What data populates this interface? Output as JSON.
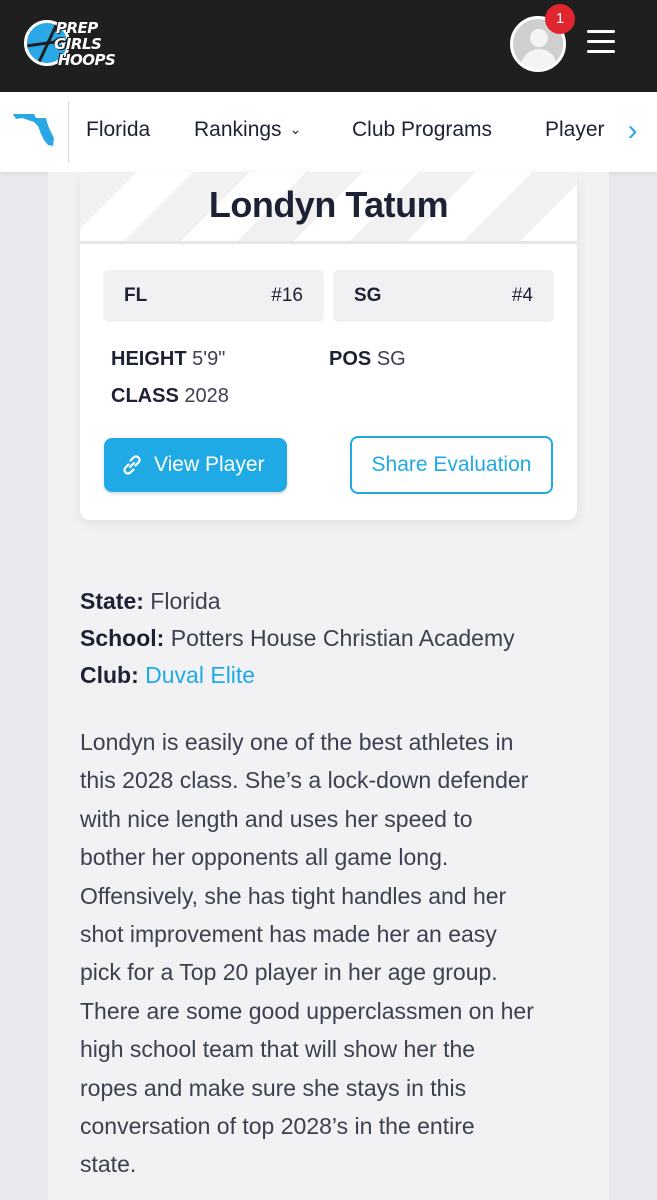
{
  "header": {
    "logo_words": [
      "PREP",
      "GIRLS",
      "HOOPS"
    ],
    "notification_count": "1"
  },
  "nav": {
    "items": [
      {
        "label": "Florida"
      },
      {
        "label": "Rankings",
        "has_dropdown": true
      },
      {
        "label": "Club Programs"
      },
      {
        "label": "Player"
      }
    ],
    "next_arrow": "›"
  },
  "player": {
    "name": "Londyn Tatum",
    "rankings": [
      {
        "label": "FL",
        "value": "#16"
      },
      {
        "label": "SG",
        "value": "#4"
      }
    ],
    "height_label": "HEIGHT",
    "height_value": "5'9\"",
    "pos_label": "POS",
    "pos_value": "SG",
    "class_label": "CLASS",
    "class_value": "2028"
  },
  "actions": {
    "view_player": "View Player",
    "share_evaluation": "Share Evaluation"
  },
  "details": {
    "state_label": "State:",
    "state_value": "Florida",
    "school_label": "School:",
    "school_value": "Potters House Christian Academy",
    "club_label": "Club:",
    "club_value": "Duval Elite"
  },
  "evaluation_lines": [
    "Londyn is easily one of the best athletes in",
    "this 2028 class. She’s a lock-down defender",
    "with nice length and uses her speed to",
    "bother her opponents all game long.",
    "Offensively, she has tight handles and her",
    "shot improvement has made her an easy",
    "pick for a Top 20 player in her age group.",
    "There are some good upperclassmen on her",
    "high school team that will show her the",
    "ropes and make sure she stays in this",
    "conversation of top 2028’s in the entire",
    "state."
  ],
  "colors": {
    "accent": "#1faae6",
    "header_bg": "#1f1f1f",
    "badge": "#e0252f",
    "text_dark": "#1c2234"
  }
}
